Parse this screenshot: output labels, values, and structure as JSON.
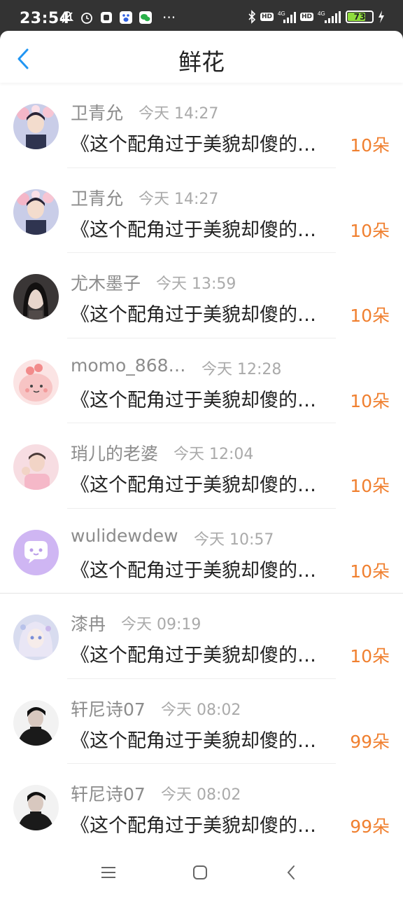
{
  "status_bar": {
    "time": "23:54",
    "battery": "73",
    "battery_level": 0.73,
    "network": "4G",
    "hd": "HD"
  },
  "header": {
    "title": "鲜花",
    "back_icon": "chevron-left-icon"
  },
  "colors": {
    "accent_blue": "#2196f3",
    "flower_orange": "#f08030",
    "name_gray": "#8c8c8c",
    "time_gray": "#aaaaaa"
  },
  "rows": [
    {
      "name": "卫青允",
      "time": "今天 14:27",
      "title": "《这个配角过于美貌却傻的…",
      "count": "10朵",
      "avatar": "avatar-boy-flowers"
    },
    {
      "name": "卫青允",
      "time": "今天 14:27",
      "title": "《这个配角过于美貌却傻的…",
      "count": "10朵",
      "avatar": "avatar-boy-flowers"
    },
    {
      "name": "尤木墨子",
      "time": "今天 13:59",
      "title": "《这个配角过于美貌却傻的…",
      "count": "10朵",
      "avatar": "avatar-girl-dark"
    },
    {
      "name": "momo_868…",
      "time": "今天 12:28",
      "title": "《这个配角过于美貌却傻的…",
      "count": "10朵",
      "avatar": "avatar-pink-cartoon"
    },
    {
      "name": "琑儿的老婆",
      "time": "今天 12:04",
      "title": "《这个配角过于美貌却傻的…",
      "count": "10朵",
      "avatar": "avatar-boy-pink"
    },
    {
      "name": "wulidewdew",
      "time": "今天 10:57",
      "title": "《这个配角过于美貌却傻的…",
      "count": "10朵",
      "avatar": "avatar-chat-bubble"
    },
    {
      "name": "漆冉",
      "time": "今天 09:19",
      "title": "《这个配角过于美貌却傻的…",
      "count": "10朵",
      "avatar": "avatar-anime-girl"
    },
    {
      "name": "轩尼诗07",
      "time": "今天 08:02",
      "title": "《这个配角过于美貌却傻的…",
      "count": "99朵",
      "avatar": "avatar-man-dark"
    },
    {
      "name": "轩尼诗07",
      "time": "今天 08:02",
      "title": "《这个配角过于美貌却傻的…",
      "count": "99朵",
      "avatar": "avatar-man-dark"
    }
  ],
  "nav_bar": {
    "menu_icon": "menu-icon",
    "home_icon": "home-icon",
    "back_icon": "back-icon"
  }
}
